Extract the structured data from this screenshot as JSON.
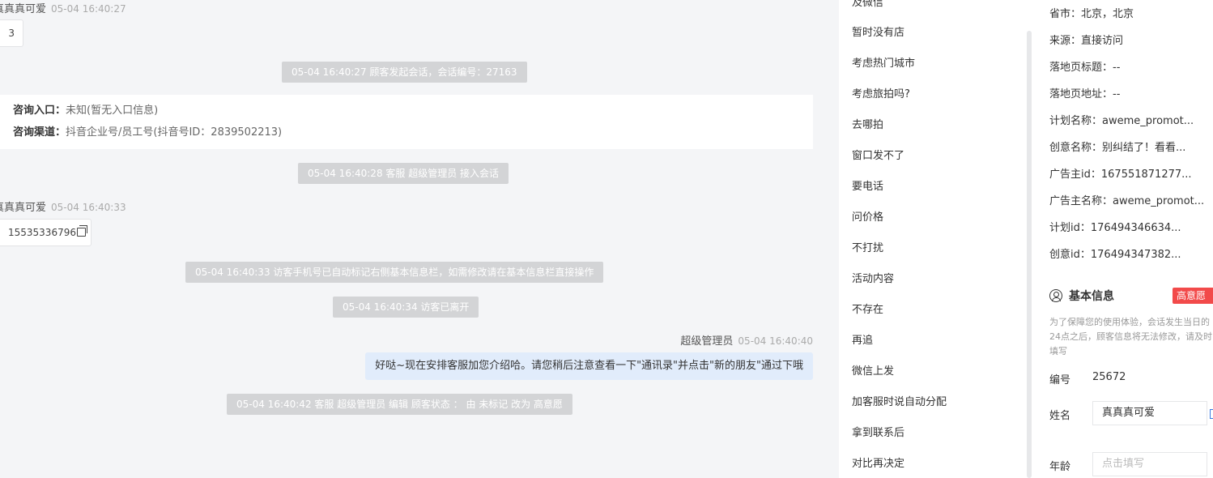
{
  "chat": {
    "msg1": {
      "sender": "真真真可爱",
      "time": "05-04 16:40:27",
      "content": "3"
    },
    "sys1": "05-04 16:40:27 顾客发起会话，会话编号：27163",
    "info_card": {
      "entry_label": "咨询入口：",
      "entry_value": "未知(暂无入口信息)",
      "channel_label": "咨询渠道：",
      "channel_value": "抖音企业号/员工号(抖音号ID：2839502213)"
    },
    "sys2": "05-04 16:40:28 客服 超级管理员 接入会话",
    "msg2": {
      "sender": "真真真可爱",
      "time": "05-04 16:40:33",
      "content": "15535336796"
    },
    "sys3": "05-04 16:40:33 访客手机号已自动标记右侧基本信息栏，如需修改请在基本信息栏直接操作",
    "sys4": "05-04 16:40:34 访客已离开",
    "msg3": {
      "sender": "超级管理员",
      "time": "05-04 16:40:40",
      "content": "好哒~现在安排客服加您介绍哈。请您稍后注意查看一下\"通讯录\"并点击\"新的朋友\"通过下哦"
    },
    "sys5": "05-04 16:40:42 客服 超级管理员 编辑 顾客状态 ： 由 未标记 改为 高意愿"
  },
  "tags": [
    "及微信",
    "暂时没有店",
    "考虑热门城市",
    "考虑旅拍吗?",
    "去哪拍",
    "窗口发不了",
    "要电话",
    "问价格",
    "不打扰",
    "活动内容",
    "不存在",
    "再追",
    "微信上发",
    "加客服时说自动分配",
    "拿到联系后",
    "对比再决定"
  ],
  "source_info": [
    {
      "label": "省市：",
      "value": "北京，北京"
    },
    {
      "label": "来源：",
      "value": "直接访问"
    },
    {
      "label": "落地页标题：",
      "value": "--"
    },
    {
      "label": "落地页地址：",
      "value": "--"
    },
    {
      "label": "计划名称：",
      "value": "aweme_promot..."
    },
    {
      "label": "创意名称：",
      "value": "别纠结了！看看..."
    },
    {
      "label": "广告主id：",
      "value": "167551871277..."
    },
    {
      "label": "广告主名称：",
      "value": "aweme_promot..."
    },
    {
      "label": "计划id：",
      "value": "176494346634..."
    },
    {
      "label": "创意id：",
      "value": "176494347382..."
    }
  ],
  "basic": {
    "title": "基本信息",
    "badge": "高意愿",
    "notice": "为了保障您的使用体验，会话发生当日的24点之后，顾客信息将无法修改，请及时填写",
    "id_label": "编号",
    "id_value": "25672",
    "name_label": "姓名",
    "name_value": "真真真可爱",
    "age_label": "年龄",
    "age_placeholder": "点击填写"
  }
}
